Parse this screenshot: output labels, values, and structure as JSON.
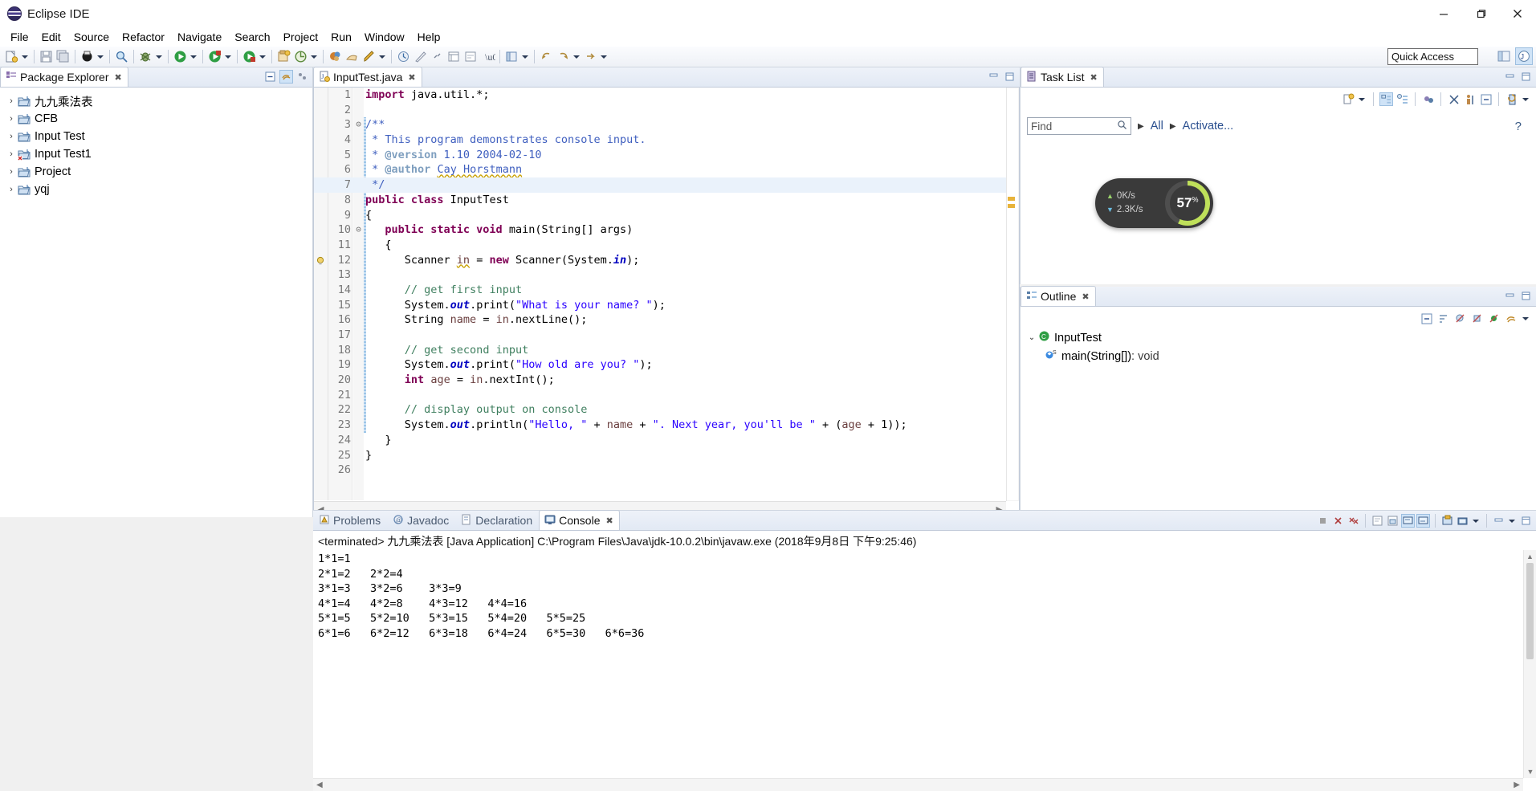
{
  "window": {
    "title": "Eclipse IDE",
    "icon": "eclipse-logo-icon",
    "minimize": "—",
    "maximize": "❐",
    "close": "✕"
  },
  "menubar": {
    "items": [
      "File",
      "Edit",
      "Source",
      "Refactor",
      "Navigate",
      "Search",
      "Project",
      "Run",
      "Window",
      "Help"
    ]
  },
  "toolbar": {
    "quick_access_placeholder": "Quick Access",
    "quick_access_value": "Quick Access"
  },
  "package_explorer": {
    "tab_label": "Package Explorer",
    "tab_close": "✖",
    "items": [
      {
        "label": "九九乘法表",
        "twisty": "›"
      },
      {
        "label": "CFB",
        "twisty": "›"
      },
      {
        "label": "Input Test",
        "twisty": "›"
      },
      {
        "label": "Input Test1",
        "twisty": "›"
      },
      {
        "label": "Project",
        "twisty": "›"
      },
      {
        "label": "yqj",
        "twisty": "›"
      }
    ]
  },
  "editor": {
    "tab_label": "InputTest.java",
    "tab_close": "✖",
    "lines": [
      {
        "n": "1",
        "fold": "",
        "html": "<span class=\"k\">import</span> java.util.*;"
      },
      {
        "n": "2",
        "fold": "",
        "html": ""
      },
      {
        "n": "3",
        "fold": "⊝",
        "html": "<span class=\"jd\">/**</span>"
      },
      {
        "n": "4",
        "fold": "",
        "html": "<span class=\"jd\"> * This program demonstrates console input.</span>"
      },
      {
        "n": "5",
        "fold": "",
        "html": "<span class=\"jd\"> * </span><span class=\"jdt\">@version</span><span class=\"jd\"> 1.10 2004-02-10</span>"
      },
      {
        "n": "6",
        "fold": "",
        "html": "<span class=\"jd\"> * </span><span class=\"jdt\">@author</span><span class=\"jd\"> </span><span class=\"jd squig\">Cay Horstmann</span>"
      },
      {
        "n": "7",
        "fold": "",
        "hl": true,
        "html": "<span class=\"jd\"> */</span>"
      },
      {
        "n": "8",
        "fold": "",
        "html": "<span class=\"k\">public class</span> InputTest"
      },
      {
        "n": "9",
        "fold": "",
        "html": "{"
      },
      {
        "n": "10",
        "fold": "⊝",
        "html": "   <span class=\"k\">public static void</span> main(String[] args)"
      },
      {
        "n": "11",
        "fold": "",
        "html": "   {"
      },
      {
        "n": "12",
        "fold": "",
        "mark": "bulb",
        "html": "      Scanner <span class=\"loc squig\">in</span> = <span class=\"k\">new</span> Scanner(System.<span class=\"fld\">in</span>);"
      },
      {
        "n": "13",
        "fold": "",
        "html": ""
      },
      {
        "n": "14",
        "fold": "",
        "html": "      <span class=\"c\">// get first input</span>"
      },
      {
        "n": "15",
        "fold": "",
        "html": "      System.<span class=\"fld\">out</span>.print(<span class=\"s\">\"What is your name? \"</span>);"
      },
      {
        "n": "16",
        "fold": "",
        "html": "      String <span class=\"loc\">name</span> = <span class=\"loc\">in</span>.nextLine();"
      },
      {
        "n": "17",
        "fold": "",
        "html": ""
      },
      {
        "n": "18",
        "fold": "",
        "html": "      <span class=\"c\">// get second input</span>"
      },
      {
        "n": "19",
        "fold": "",
        "html": "      System.<span class=\"fld\">out</span>.print(<span class=\"s\">\"How old are you? \"</span>);"
      },
      {
        "n": "20",
        "fold": "",
        "html": "      <span class=\"k\">int</span> <span class=\"loc\">age</span> = <span class=\"loc\">in</span>.nextInt();"
      },
      {
        "n": "21",
        "fold": "",
        "html": ""
      },
      {
        "n": "22",
        "fold": "",
        "html": "      <span class=\"c\">// display output on console</span>"
      },
      {
        "n": "23",
        "fold": "",
        "html": "      System.<span class=\"fld\">out</span>.println(<span class=\"s\">\"Hello, \"</span> + <span class=\"loc\">name</span> + <span class=\"s\">\". Next year, you'll be \"</span> + (<span class=\"loc\">age</span> + 1));"
      },
      {
        "n": "24",
        "fold": "",
        "html": "   }"
      },
      {
        "n": "25",
        "fold": "",
        "html": "}"
      },
      {
        "n": "26",
        "fold": "",
        "html": ""
      }
    ]
  },
  "task_list": {
    "tab_label": "Task List",
    "tab_close": "✖",
    "find_placeholder": "Find",
    "find_value": "Find",
    "all_label": "All",
    "activate_label": "Activate...",
    "help_icon": "?"
  },
  "outline": {
    "tab_label": "Outline",
    "tab_close": "✖",
    "root": {
      "label": "InputTest",
      "twisty": "⌄"
    },
    "members": [
      {
        "label": "main(String[])",
        "suffix": " : void"
      }
    ]
  },
  "bottom_panel": {
    "tabs": [
      {
        "label": "Problems",
        "icon": "problems-icon",
        "active": false
      },
      {
        "label": "Javadoc",
        "icon": "javadoc-icon",
        "active": false
      },
      {
        "label": "Declaration",
        "icon": "declaration-icon",
        "active": false
      },
      {
        "label": "Console",
        "icon": "console-icon",
        "active": true
      }
    ],
    "console_header": "<terminated> 九九乘法表 [Java Application] C:\\Program Files\\Java\\jdk-10.0.2\\bin\\javaw.exe (2018年9月8日 下午9:25:46)",
    "console_output": "1*1=1\n2*1=2\t2*2=4\n3*1=3\t3*2=6\t3*3=9\n4*1=4\t4*2=8\t4*3=12\t4*4=16\n5*1=5\t5*2=10\t5*3=15\t5*4=20\t5*5=25\n6*1=6\t6*2=12\t6*3=18\t6*4=24\t6*5=30\t6*6=36"
  },
  "net_widget": {
    "upload": "0K/s",
    "download": "2.3K/s",
    "percent": "57",
    "percent_unit": "%"
  },
  "colors": {
    "accent": "#2a4f8f",
    "keyword": "#7f0055",
    "string": "#2a00ff",
    "comment": "#3f7f5f",
    "javadoc": "#3f5fbf",
    "selection": "#eaf2fb",
    "net_ring": "#bfe05a"
  }
}
